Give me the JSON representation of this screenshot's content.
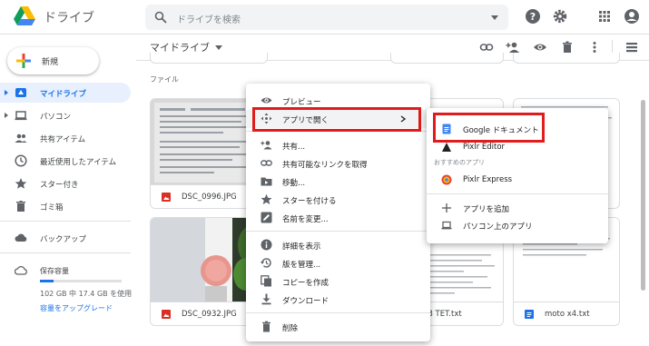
{
  "header": {
    "app_title": "ドライブ",
    "search_placeholder": "ドライブを検索"
  },
  "sidebar": {
    "new_label": "新規",
    "items": [
      {
        "label": "マイドライブ",
        "active": true
      },
      {
        "label": "パソコン"
      },
      {
        "label": "共有アイテム"
      },
      {
        "label": "最近使用したアイテム"
      },
      {
        "label": "スター付き"
      },
      {
        "label": "ゴミ箱"
      },
      {
        "label": "バックアップ"
      }
    ],
    "storage": {
      "title": "保存容量",
      "usage_text": "102 GB 中 17.4 GB を使用",
      "used_gb": 17.4,
      "total_gb": 102,
      "upgrade": "容量をアップグレード"
    }
  },
  "main": {
    "breadcrumb": "マイドライブ",
    "files_heading": "ファイル",
    "files": [
      {
        "name": "DSC_0996.JPG"
      },
      {
        "name": "DSC_0932.JPG"
      },
      {
        "name": "0171103 TET.txt"
      },
      {
        "name": "moto x4.txt"
      }
    ]
  },
  "context_menu": {
    "items": [
      {
        "label": "プレビュー",
        "icon": "eye-icon"
      },
      {
        "label": "アプリで開く",
        "icon": "open-with-icon",
        "submenu": true
      },
      {
        "label": "共有...",
        "icon": "person-add-icon"
      },
      {
        "label": "共有可能なリンクを取得",
        "icon": "link-icon"
      },
      {
        "label": "移動...",
        "icon": "folder-move-icon"
      },
      {
        "label": "スターを付ける",
        "icon": "star-icon"
      },
      {
        "label": "名前を変更...",
        "icon": "rename-icon"
      },
      {
        "label": "詳細を表示",
        "icon": "info-icon"
      },
      {
        "label": "版を管理...",
        "icon": "history-icon"
      },
      {
        "label": "コピーを作成",
        "icon": "copy-icon"
      },
      {
        "label": "ダウンロード",
        "icon": "download-icon"
      },
      {
        "label": "削除",
        "icon": "trash-icon"
      }
    ]
  },
  "open_with_submenu": {
    "items": [
      {
        "label": "Google ドキュメント",
        "icon": "google-docs-icon"
      },
      {
        "label": "Pixlr Editor",
        "icon": "pixlr-editor-icon"
      }
    ],
    "suggested_label": "おすすめのアプリ",
    "suggested": [
      {
        "label": "Pixlr Express",
        "icon": "pixlr-express-icon"
      }
    ],
    "actions": [
      {
        "label": "アプリを追加",
        "icon": "plus-icon"
      },
      {
        "label": "パソコン上のアプリ",
        "icon": "laptop-icon"
      }
    ]
  },
  "colors": {
    "accent": "#1a73e8",
    "highlight": "#e01c1c",
    "image_icon": "#d93025"
  }
}
